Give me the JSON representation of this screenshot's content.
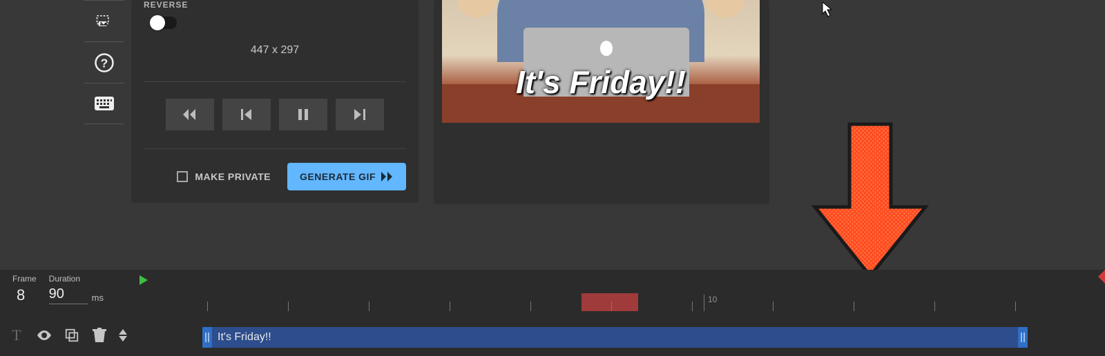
{
  "controls": {
    "reverse_label": "REVERSE",
    "dimensions": "447 x 297",
    "make_private_label": "MAKE PRIVATE",
    "generate_label": "GENERATE GIF"
  },
  "preview": {
    "overlay_text": "It's Friday!!"
  },
  "timeline": {
    "frame_label": "Frame",
    "duration_label": "Duration",
    "frame_value": "8",
    "duration_value": "90",
    "duration_unit": "ms",
    "ruler_tick_label": "10",
    "clip_text": "It's Friday!!"
  }
}
